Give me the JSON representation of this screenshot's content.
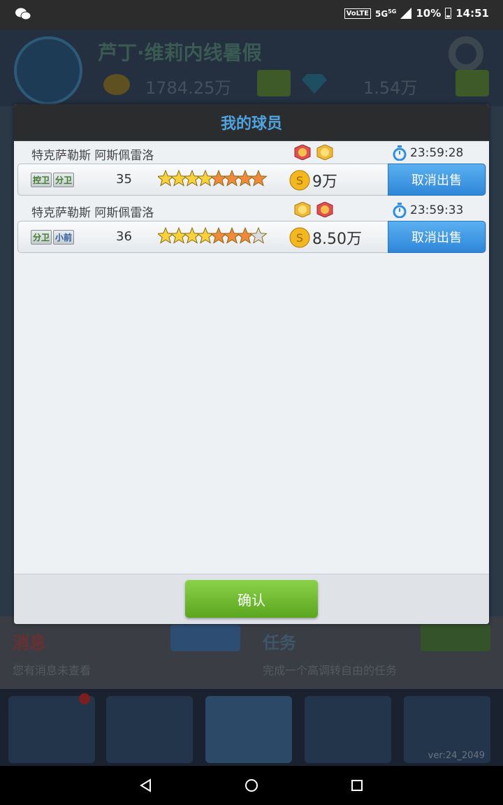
{
  "status_bar": {
    "volte": "VoLTE",
    "network": "5G",
    "network_sup": "5G",
    "battery": "10%",
    "time": "14:51",
    "icons": [
      "wechat-icon",
      "signal-icon",
      "battery-icon"
    ]
  },
  "background": {
    "club_name": "芦丁·维莉内线暑假",
    "coins": "1784.25万",
    "gems": "1.54万",
    "panel_left_title": "消息",
    "panel_left_text": "您有消息未查看",
    "panel_right_title": "任务",
    "panel_right_text": "完成一个高调转自由的任务",
    "version": "ver:24_2049"
  },
  "dialog": {
    "title": "我的球员",
    "confirm_label": "确认",
    "items": [
      {
        "name": "特克萨勒斯 阿斯佩雷洛",
        "timer": "23:59:28",
        "positions": [
          "控卫",
          "分卫"
        ],
        "position_colors": [
          "green",
          "green"
        ],
        "rating": "35",
        "stars": 7.5,
        "price": "9万",
        "cancel_label": "取消出售"
      },
      {
        "name": "特克萨勒斯 阿斯佩雷洛",
        "timer": "23:59:33",
        "positions": [
          "分卫",
          "小前"
        ],
        "position_colors": [
          "green",
          "blue"
        ],
        "rating": "36",
        "stars": 7,
        "price": "8.50万",
        "cancel_label": "取消出售"
      }
    ]
  },
  "colors": {
    "title_blue": "#4fa3e0",
    "cancel_blue": "#2f86d8",
    "confirm_green": "#6ab82e",
    "star_gold": "#f7d23a",
    "star_orange": "#f08a3a"
  }
}
